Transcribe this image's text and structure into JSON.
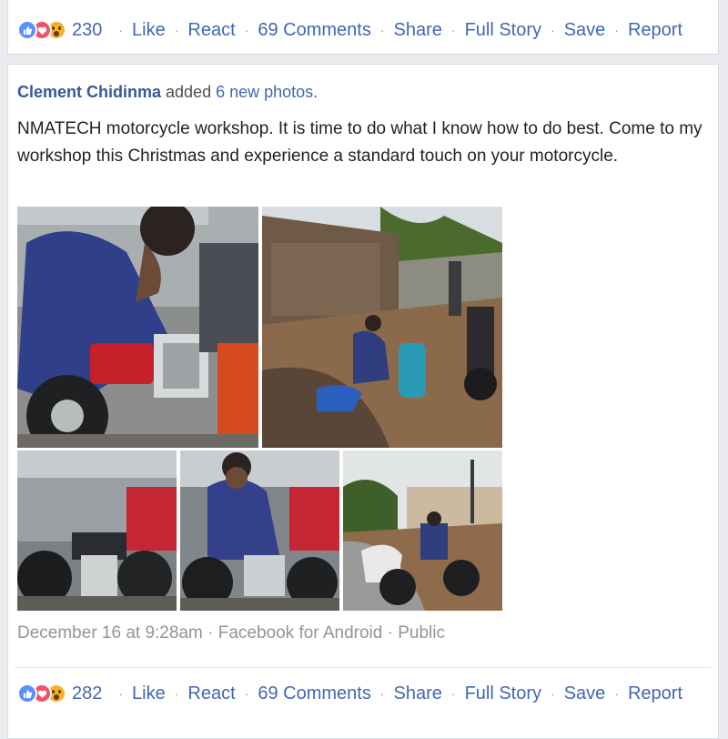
{
  "top_bar": {
    "reaction_count": "230",
    "like": "Like",
    "react": "React",
    "comments": "69 Comments",
    "share": "Share",
    "full_story": "Full Story",
    "save": "Save",
    "report": "Report"
  },
  "post": {
    "author": "Clement Chidinma",
    "action_text": " added ",
    "photos_link": "6 new photos",
    "photos_suffix": ".",
    "text": "NMATECH motorcycle workshop. It is time to do what I know how to do best. Come to my workshop this Christmas and experience a standard touch on your motorcycle.",
    "date": "December  16 at 9:28am",
    "source": "Facebook for Android",
    "privacy": "Public",
    "sep": "·"
  },
  "bottom_bar": {
    "reaction_count": "282",
    "like": "Like",
    "react": "React",
    "comments": "69 Comments",
    "share": "Share",
    "full_story": "Full Story",
    "save": "Save",
    "report": "Report"
  },
  "icons": [
    "like-reaction-icon",
    "love-reaction-icon",
    "wow-reaction-icon"
  ],
  "colors": {
    "link": "#4267b2",
    "author": "#365899",
    "like": "#5890ff",
    "love": "#f25268",
    "wow": "#f7b125"
  }
}
